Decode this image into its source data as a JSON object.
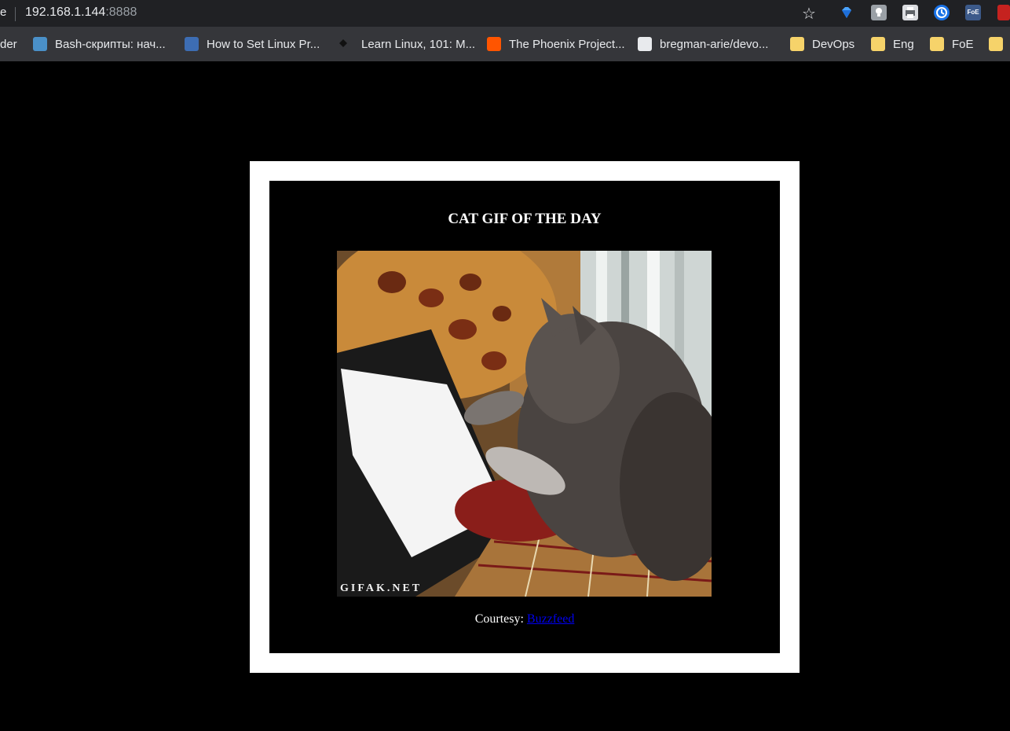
{
  "browser": {
    "tab_tail": "e",
    "url_host": "192.168.1.144",
    "url_port": ":8888",
    "extension_foe_label": "FoE",
    "bookmarks": [
      {
        "label": "der",
        "icon": "none"
      },
      {
        "label": "Bash-скрипты: нач...",
        "icon": "bash-site-icon"
      },
      {
        "label": "How to Set Linux Pr...",
        "icon": "howto-site-icon"
      },
      {
        "label": "Learn Linux, 101: M...",
        "icon": "learn-linux-icon"
      },
      {
        "label": "The Phoenix Project...",
        "icon": "soundcloud-icon"
      },
      {
        "label": "bregman-arie/devo...",
        "icon": "github-icon"
      },
      {
        "label": "DevOps",
        "icon": "folder-icon"
      },
      {
        "label": "Eng",
        "icon": "folder-icon"
      },
      {
        "label": "FoE",
        "icon": "folder-icon"
      }
    ]
  },
  "page": {
    "title": "CAT GIF OF THE DAY",
    "gif_watermark": "GIFAK.NET",
    "courtesy_prefix": "Courtesy: ",
    "courtesy_link": "Buzzfeed",
    "colors": {
      "page_background": "#000000",
      "frame": "#ffffff",
      "link": "#0000ee"
    }
  }
}
